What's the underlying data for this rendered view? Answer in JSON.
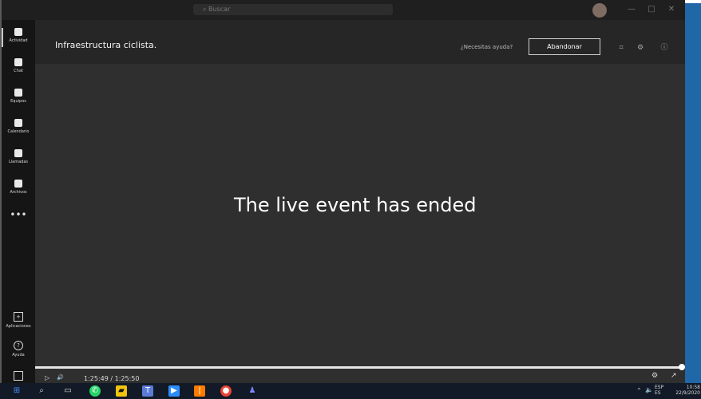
{
  "window": {
    "search_text": "Buscar",
    "minimize": "—",
    "maximize": "□",
    "close": "✕"
  },
  "sidebar": {
    "items": [
      {
        "label": "Actividad",
        "icon": "bell-icon"
      },
      {
        "label": "Chat",
        "icon": "chat-icon"
      },
      {
        "label": "Equipos",
        "icon": "teams-icon"
      },
      {
        "label": "Calendario",
        "icon": "calendar-icon"
      },
      {
        "label": "Llamadas",
        "icon": "phone-icon"
      },
      {
        "label": "Archivos",
        "icon": "file-icon"
      }
    ],
    "more": "•••",
    "apps_label": "Aplicaciones",
    "help_label": "Ayuda"
  },
  "meeting": {
    "title": "Infraestructura ciclista.",
    "help_text": "¿Necesitas ayuda?",
    "leave_label": "Abandonar",
    "ended_message": "The live event has ended"
  },
  "player": {
    "current_time": "1:25:49",
    "separator": "/",
    "duration": "1:25:50",
    "progress_fraction": 0.999
  },
  "taskbar": {
    "tray": {
      "language_top": "ESP",
      "language_bottom": "ES",
      "time": "10:58",
      "date": "22/9/2020"
    }
  },
  "colors": {
    "video_background": "#2f2f2f",
    "rail_background": "#151515",
    "taskbar_background": "#111a26",
    "accent_blue": "#1f67a7"
  }
}
